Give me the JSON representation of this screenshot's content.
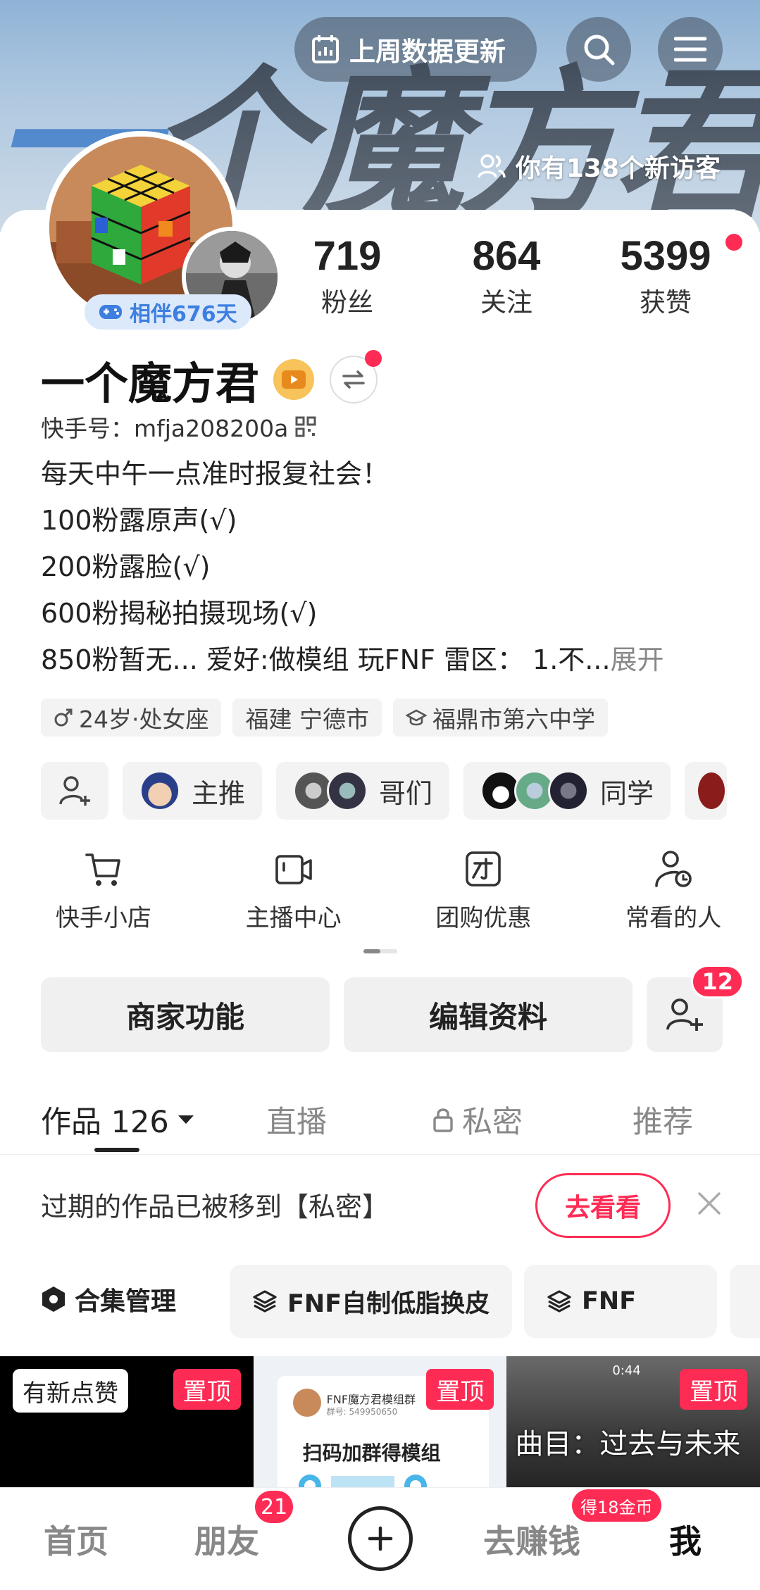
{
  "header": {
    "banner_title": "一个魔方君",
    "update_label": "上周数据更新",
    "visitors_label": "你有138个新访客"
  },
  "profile": {
    "companion_label": "相伴676天",
    "name": "一个魔方君",
    "kwai_id": "快手号：mfja208200a",
    "stats": [
      {
        "value": "719",
        "label": "粉丝"
      },
      {
        "value": "864",
        "label": "关注"
      },
      {
        "value": "5399",
        "label": "获赞"
      }
    ],
    "bio_lines": [
      "每天中午一点准时报复社会！",
      "100粉露原声(√)",
      "200粉露脸(√)",
      "600粉揭秘拍摄现场(√)",
      "850粉暂无... 爱好:做模组  玩FNF 雷区：  1.不..."
    ],
    "bio_more": "展开",
    "tags": [
      "24岁·处女座",
      "福建 宁德市",
      "福鼎市第六中学"
    ]
  },
  "groups": [
    "主推",
    "哥们",
    "同学"
  ],
  "services": [
    {
      "label": "快手小店",
      "icon": "cart-icon"
    },
    {
      "label": "主播中心",
      "icon": "camera-icon"
    },
    {
      "label": "团购优惠",
      "icon": "group-buy-icon"
    },
    {
      "label": "常看的人",
      "icon": "person-clock-icon"
    }
  ],
  "actions": {
    "merchant": "商家功能",
    "edit_profile": "编辑资料",
    "add_friend_badge": "12"
  },
  "tabs": {
    "works": "作品 126",
    "live": "直播",
    "private": "私密",
    "recommend": "推荐"
  },
  "notice": {
    "text": "过期的作品已被移到【私密】",
    "button": "去看看"
  },
  "collections": {
    "manage": "合集管理",
    "items": [
      "FNF自制低脂换皮",
      "FNF"
    ]
  },
  "thumbnails": {
    "new_like": "有新点赞",
    "pinned": "置顶",
    "qr_title": "FNF魔方君模组群",
    "qr_group_no": "群号: 549950650",
    "qr_caption": "扫码加群得模组",
    "video_time": "0:44",
    "song_caption": "曲目：过去与未来"
  },
  "bottom_nav": {
    "home": "首页",
    "friends": "朋友",
    "friends_badge": "21",
    "earn": "去赚钱",
    "earn_badge": "得18金币",
    "me": "我"
  },
  "colors": {
    "accent": "#fe2c55",
    "companion_blue": "#3d7fe0"
  }
}
